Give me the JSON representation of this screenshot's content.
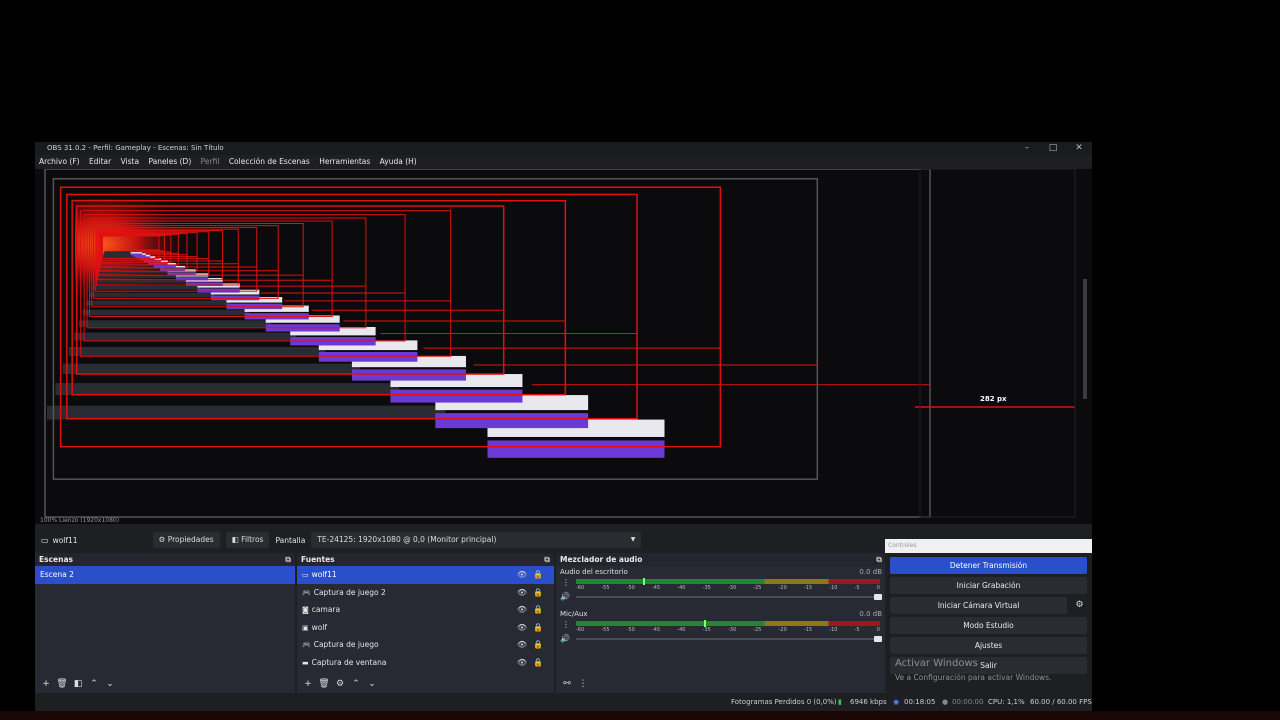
{
  "window": {
    "title": "OBS 31.0.2 - Perfil: Gameplay - Escenas: Sin Título",
    "minimize": "–",
    "maximize": "□",
    "close": "✕"
  },
  "menu": [
    {
      "label": "Archivo (F)",
      "dim": false
    },
    {
      "label": "Editar",
      "dim": false
    },
    {
      "label": "Vista",
      "dim": false
    },
    {
      "label": "Paneles (D)",
      "dim": false
    },
    {
      "label": "Perfil",
      "dim": true
    },
    {
      "label": "Colección de Escenas",
      "dim": false
    },
    {
      "label": "Herramientas",
      "dim": false
    },
    {
      "label": "Ayuda (H)",
      "dim": false
    }
  ],
  "preview": {
    "measure_label": "282 px",
    "scale_text": "100%   Lienzo (1920x1080)"
  },
  "source_toolbar": {
    "source_name": "wolf11",
    "properties": "Propiedades",
    "filters": "Filtros",
    "display_label": "Pantalla",
    "display_value": "TE-24125: 1920x1080 @ 0,0 (Monitor principal)"
  },
  "scenes": {
    "title": "Escenas",
    "items": [
      "Escena 2"
    ]
  },
  "sources": {
    "title": "Fuentes",
    "items": [
      {
        "label": "wolf11",
        "icon": "monitor-icon"
      },
      {
        "label": "Captura de juego 2",
        "icon": "gamepad-icon"
      },
      {
        "label": "camara",
        "icon": "camera-icon"
      },
      {
        "label": "wolf",
        "icon": "image-icon"
      },
      {
        "label": "Captura de juego",
        "icon": "gamepad-icon"
      },
      {
        "label": "Captura de ventana",
        "icon": "window-icon"
      }
    ]
  },
  "mixer": {
    "title": "Mezclador de audio",
    "channels": [
      {
        "name": "Audio del escritorio",
        "db": "0.0 dB",
        "level": 0.22
      },
      {
        "name": "Mic/Aux",
        "db": "0.0 dB",
        "level": 0.42
      }
    ],
    "ticks": [
      "-60",
      "-55",
      "-50",
      "-45",
      "-40",
      "-35",
      "-30",
      "-25",
      "-20",
      "-15",
      "-10",
      "-5",
      "0"
    ]
  },
  "controls": {
    "title": "Controles",
    "buttons": [
      "Detener Transmisión",
      "Iniciar Grabación",
      "Iniciar Cámara Virtual",
      "Modo Estudio",
      "Ajustes",
      "Salir"
    ]
  },
  "watermark": {
    "line1": "Activar Windows",
    "line2": "Ve a Configuración para activar Windows."
  },
  "status": {
    "dropped": "Fotogramas Perdidos 0 (0,0%)",
    "bitrate": "6946 kbps",
    "stream_time": "00:18:05",
    "rec_time": "00:00:00",
    "cpu": "CPU: 1,1%",
    "fps": "60.00 / 60.00 FPS"
  },
  "colors": {
    "accent": "#2b4ecb",
    "preview_red": "#e01010"
  }
}
